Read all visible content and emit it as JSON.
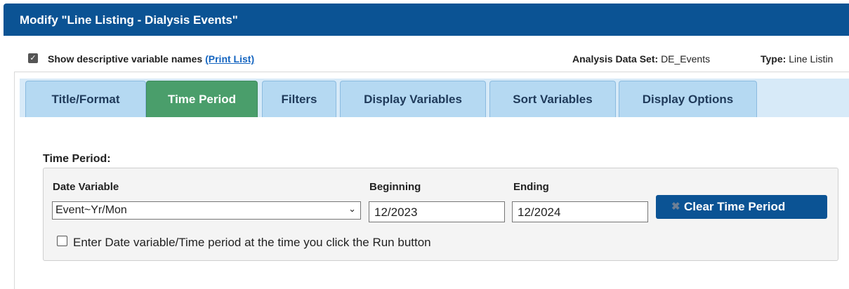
{
  "header": {
    "title": "Modify \"Line Listing - Dialysis Events\""
  },
  "options": {
    "descriptive_names_label": "Show descriptive variable names",
    "print_list_link": "(Print List)",
    "analysis_data_set_label": "Analysis Data Set:",
    "analysis_data_set_value": "DE_Events",
    "type_label": "Type:",
    "type_value": "Line Listin"
  },
  "tabs": [
    {
      "label": "Title/Format",
      "active": false
    },
    {
      "label": "Time Period",
      "active": true
    },
    {
      "label": "Filters",
      "active": false
    },
    {
      "label": "Display Variables",
      "active": false
    },
    {
      "label": "Sort Variables",
      "active": false
    },
    {
      "label": "Display Options",
      "active": false
    }
  ],
  "time_period": {
    "section_title": "Time Period:",
    "date_variable_label": "Date Variable",
    "date_variable_value": "Event~Yr/Mon",
    "beginning_label": "Beginning",
    "beginning_value": "12/2023",
    "ending_label": "Ending",
    "ending_value": "12/2024",
    "clear_button": "Clear Time Period",
    "prompt_checkbox_label": "Enter Date variable/Time period at the time you click the Run button",
    "descriptive_names_checked": true,
    "prompt_checked": false
  },
  "colors": {
    "header": "#0b5394",
    "active_tab": "#4a9e6b",
    "tab": "#b5d9f2",
    "link": "#1565c0"
  }
}
